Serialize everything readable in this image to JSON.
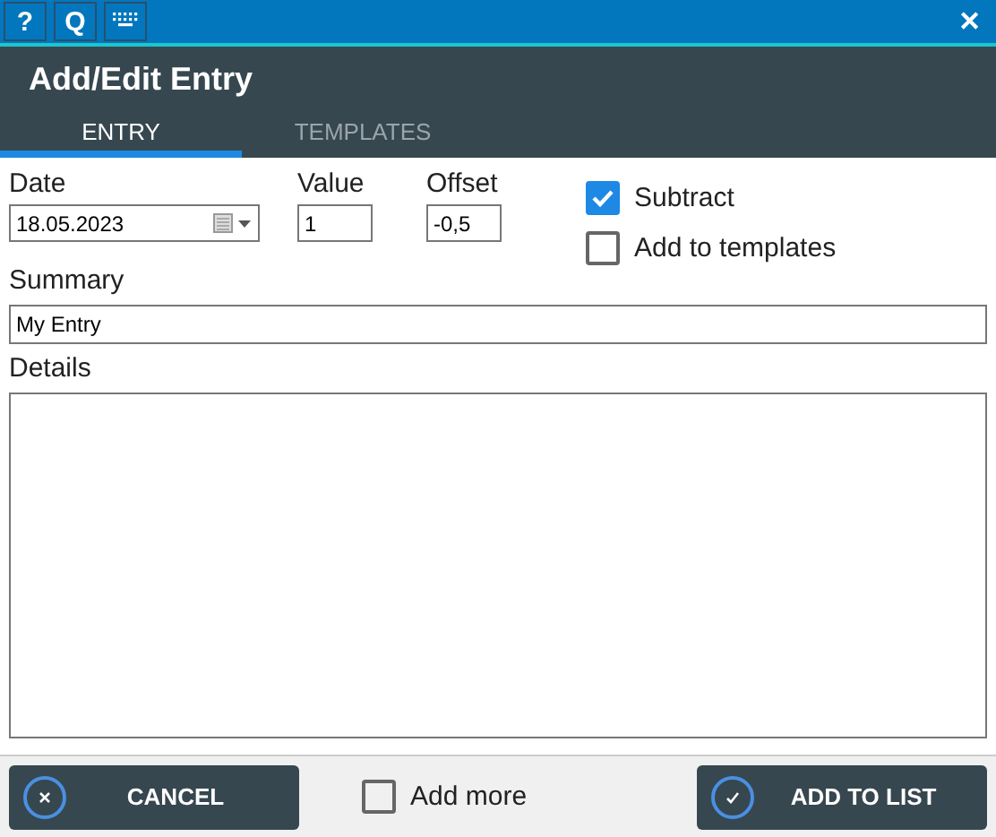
{
  "toolbar": {
    "buttons": [
      {
        "label": "?"
      },
      {
        "label": "Q"
      },
      {
        "kind": "keyboard"
      }
    ],
    "close": "✕"
  },
  "header": {
    "title": "Add/Edit Entry"
  },
  "tabs": [
    {
      "label": "ENTRY",
      "selected": true
    },
    {
      "label": "TEMPLATES",
      "selected": false
    }
  ],
  "form": {
    "date": {
      "label": "Date",
      "value": "18.05.2023"
    },
    "value": {
      "label": "Value",
      "value": "1"
    },
    "offset": {
      "label": "Offset",
      "value": "-0,5"
    },
    "checkboxes": [
      {
        "label": "Subtract",
        "checked": true
      },
      {
        "label": "Add to templates",
        "checked": false
      }
    ],
    "summary": {
      "label": "Summary",
      "value": "My Entry"
    },
    "details": {
      "label": "Details"
    }
  },
  "footer": {
    "cancel": "CANCEL",
    "add_more": {
      "label": "Add more",
      "checked": false
    },
    "add": "ADD TO LIST"
  }
}
